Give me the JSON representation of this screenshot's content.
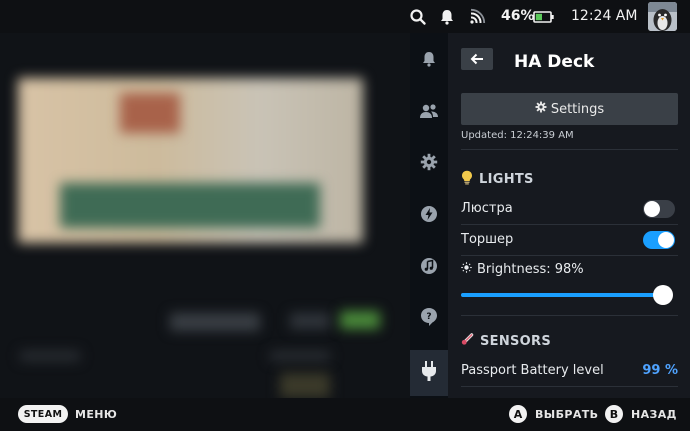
{
  "status_bar": {
    "battery_percent": "46%",
    "battery_level": 0.46,
    "time": "12:24 AM",
    "icons": [
      "search-icon",
      "notification-bell-icon",
      "wifi-icon",
      "battery-icon"
    ]
  },
  "rail": {
    "items": [
      "notifications-icon",
      "friends-icon",
      "settings-gear-icon",
      "performance-bolt-icon",
      "music-icon",
      "help-icon",
      "plugin-icon"
    ],
    "active_index": 6
  },
  "panel": {
    "title": "HA Deck",
    "settings_label": "Settings",
    "updated": "Updated: 12:24:39 AM",
    "lights": {
      "heading": "LIGHTS",
      "items": [
        {
          "label": "Люстра",
          "on": false
        },
        {
          "label": "Торшер",
          "on": true
        }
      ],
      "brightness_label": "Brightness: 98%",
      "brightness_value": 0.98
    },
    "sensors": {
      "heading": "SENSORS",
      "items": [
        {
          "label": "Passport Battery level",
          "value": "99 %"
        }
      ]
    }
  },
  "bottom_bar": {
    "steam_label": "STEAM",
    "menu_label": "МЕНЮ",
    "a_button": "A",
    "select_label": "ВЫБРАТЬ",
    "b_button": "B",
    "back_label": "НАЗАД"
  },
  "colors": {
    "accent": "#1a9fff",
    "sensor_value": "#4fa3ff",
    "panel_bg": "#16191f",
    "button_bg": "#3a4047"
  }
}
